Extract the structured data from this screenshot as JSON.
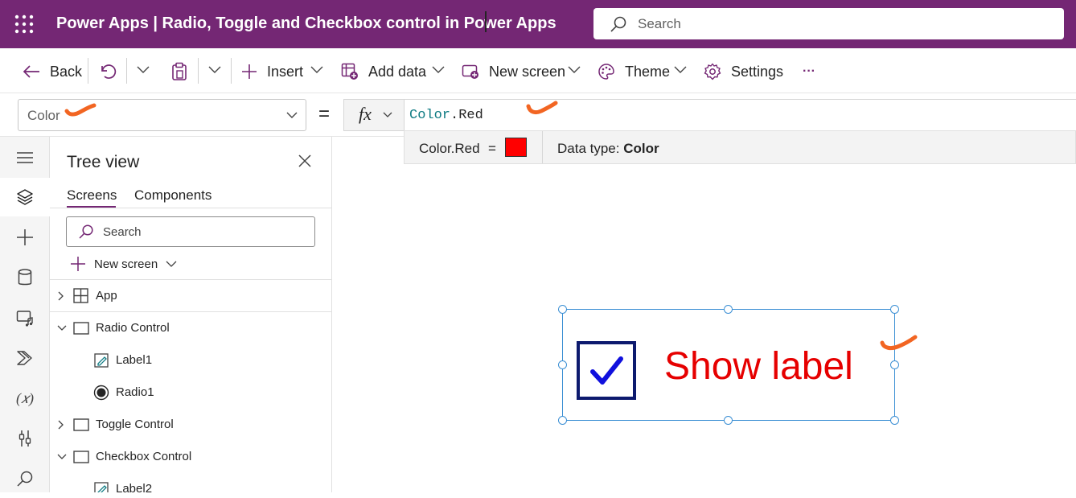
{
  "titlebar": {
    "app_title": "Power Apps  |  Radio, Toggle and Checkbox control in Power Apps",
    "search_placeholder": "Search",
    "background": "#742774"
  },
  "commands": {
    "back": "Back",
    "insert": "Insert",
    "add_data": "Add data",
    "new_screen": "New screen",
    "theme": "Theme",
    "settings": "Settings",
    "more": "···"
  },
  "formula_bar": {
    "property": "Color",
    "equals": "=",
    "fx": "fx",
    "formula_object": "Color",
    "formula_rest": ".Red"
  },
  "tip": {
    "expression": "Color.Red",
    "equals": "=",
    "swatch_color": "#ff0000",
    "data_type_label": "Data type:",
    "data_type_value": "Color"
  },
  "tree": {
    "title": "Tree view",
    "tabs": [
      "Screens",
      "Components"
    ],
    "search_placeholder": "Search",
    "new_screen": "New screen",
    "nodes": [
      {
        "label": "App",
        "icon": "app-icon"
      },
      {
        "label": "Radio Control",
        "icon": "screen-icon"
      },
      {
        "label": "Label1",
        "icon": "label-icon"
      },
      {
        "label": "Radio1",
        "icon": "radio-icon"
      },
      {
        "label": "Toggle Control",
        "icon": "screen-icon"
      },
      {
        "label": "Checkbox Control",
        "icon": "screen-icon"
      },
      {
        "label": "Label2",
        "icon": "label-icon"
      }
    ]
  },
  "canvas": {
    "checkbox_text": "Show label",
    "checkbox_checked": true,
    "text_color": "#e60000",
    "box_color": "#0d1a6e"
  },
  "annotation_color": "#f26522"
}
